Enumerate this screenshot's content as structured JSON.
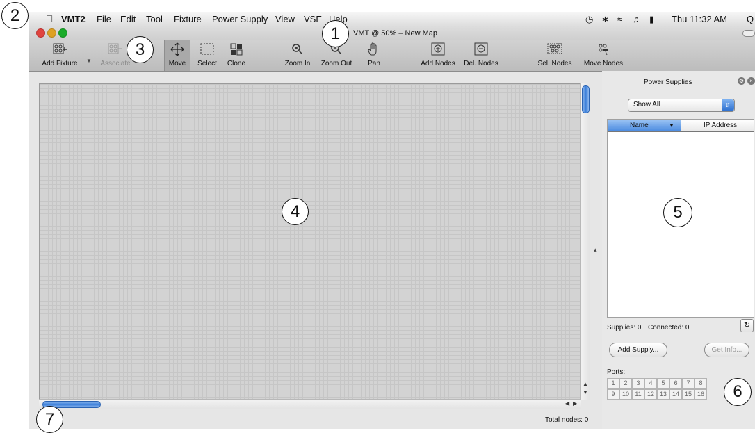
{
  "menubar": {
    "app": "VMT2",
    "items": [
      "File",
      "Edit",
      "Tool",
      "Fixture",
      "Power Supply",
      "View",
      "VSE",
      "Help"
    ],
    "clock": "Thu 11:32 AM",
    "search_glyph": "Q"
  },
  "window": {
    "title": "VMT @ 50% – New Map"
  },
  "toolbar": {
    "add_fixture": "Add Fixture",
    "associate": "Associate",
    "move": "Move",
    "select": "Select",
    "clone": "Clone",
    "zoom_in": "Zoom In",
    "zoom_out": "Zoom Out",
    "pan": "Pan",
    "add_nodes": "Add Nodes",
    "del_nodes": "Del. Nodes",
    "sel_nodes": "Sel. Nodes",
    "move_nodes": "Move Nodes"
  },
  "panel": {
    "title": "Power Supplies",
    "filter": "Show All",
    "columns": [
      "Name",
      "IP Address"
    ],
    "supplies_label": "Supplies: 0",
    "connected_label": "Connected: 0",
    "add_supply": "Add Supply...",
    "get_info": "Get Info...",
    "ports_label": "Ports:",
    "ports_row1": [
      "1",
      "2",
      "3",
      "4",
      "5",
      "6",
      "7",
      "8"
    ],
    "ports_row2": [
      "9",
      "10",
      "11",
      "12",
      "13",
      "14",
      "15",
      "16"
    ]
  },
  "status": {
    "total_nodes": "Total nodes: 0"
  },
  "callouts": [
    "1",
    "2",
    "3",
    "4",
    "5",
    "6",
    "7"
  ],
  "colors": {
    "accent": "#3b7fd9",
    "canvas": "#d3d3d3"
  }
}
